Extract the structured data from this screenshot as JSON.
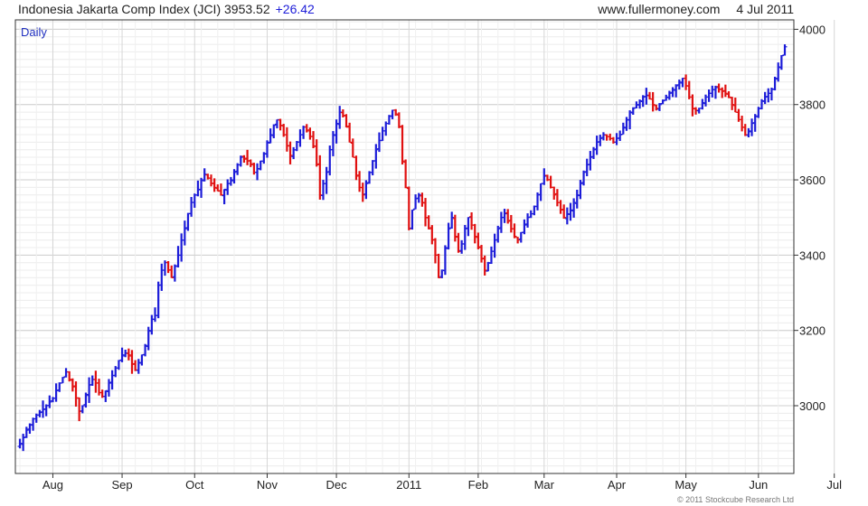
{
  "header": {
    "title": "Indonesia Jakarta Comp Index (JCI)",
    "last": "3953.52",
    "change": "+26.42",
    "site": "www.fullermoney.com",
    "date": "4 Jul 2011"
  },
  "copyright": "© 2011 Stockcube Research Ltd",
  "colors": {
    "up": "#1c1cd8",
    "down": "#e01010",
    "change": "#1c1cd8",
    "grid": "#dedede",
    "frame": "#333333"
  },
  "chart_data": {
    "type": "ohlc",
    "period": "Daily",
    "ylim": [
      2820,
      4025
    ],
    "yticks": [
      3000,
      3200,
      3400,
      3600,
      3800,
      4000
    ],
    "grid": true,
    "month_labels": [
      "Aug",
      "Sep",
      "Oct",
      "Nov",
      "Dec",
      "2011",
      "Feb",
      "Mar",
      "Apr",
      "May",
      "Jun",
      "Jul"
    ],
    "month_start_index": [
      10,
      31,
      53,
      75,
      96,
      118,
      139,
      159,
      181,
      202,
      224,
      247
    ],
    "closes": [
      2900,
      2915,
      2935,
      2950,
      2965,
      2975,
      2982,
      2990,
      3000,
      3010,
      3020,
      3040,
      3060,
      3075,
      3090,
      3070,
      3050,
      3020,
      2985,
      3000,
      3030,
      3055,
      3070,
      3060,
      3035,
      3025,
      3040,
      3060,
      3080,
      3100,
      3120,
      3135,
      3140,
      3135,
      3110,
      3095,
      3115,
      3135,
      3160,
      3200,
      3230,
      3240,
      3320,
      3360,
      3380,
      3360,
      3340,
      3370,
      3400,
      3440,
      3470,
      3510,
      3540,
      3560,
      3575,
      3600,
      3615,
      3605,
      3590,
      3580,
      3570,
      3560,
      3575,
      3590,
      3600,
      3620,
      3640,
      3660,
      3655,
      3650,
      3640,
      3620,
      3630,
      3650,
      3670,
      3700,
      3720,
      3745,
      3760,
      3745,
      3720,
      3690,
      3665,
      3680,
      3700,
      3720,
      3740,
      3730,
      3715,
      3690,
      3640,
      3560,
      3590,
      3620,
      3680,
      3720,
      3750,
      3780,
      3770,
      3740,
      3700,
      3660,
      3610,
      3580,
      3560,
      3590,
      3620,
      3650,
      3680,
      3705,
      3730,
      3750,
      3770,
      3785,
      3775,
      3740,
      3650,
      3580,
      3470,
      3520,
      3550,
      3560,
      3540,
      3500,
      3470,
      3440,
      3400,
      3340,
      3360,
      3420,
      3470,
      3500,
      3450,
      3410,
      3430,
      3470,
      3500,
      3480,
      3450,
      3420,
      3390,
      3360,
      3380,
      3410,
      3440,
      3470,
      3500,
      3510,
      3490,
      3470,
      3450,
      3440,
      3460,
      3480,
      3500,
      3510,
      3530,
      3560,
      3590,
      3610,
      3600,
      3580,
      3560,
      3540,
      3520,
      3500,
      3510,
      3520,
      3540,
      3560,
      3590,
      3620,
      3640,
      3660,
      3680,
      3700,
      3710,
      3720,
      3715,
      3710,
      3700,
      3710,
      3720,
      3740,
      3760,
      3780,
      3790,
      3800,
      3810,
      3820,
      3825,
      3815,
      3800,
      3790,
      3800,
      3810,
      3820,
      3830,
      3840,
      3850,
      3860,
      3870,
      3850,
      3820,
      3790,
      3785,
      3790,
      3805,
      3820,
      3830,
      3840,
      3845,
      3840,
      3835,
      3830,
      3820,
      3800,
      3780,
      3760,
      3740,
      3720,
      3730,
      3750,
      3770,
      3790,
      3810,
      3820,
      3830,
      3840,
      3870,
      3900,
      3930,
      3953.52
    ]
  }
}
